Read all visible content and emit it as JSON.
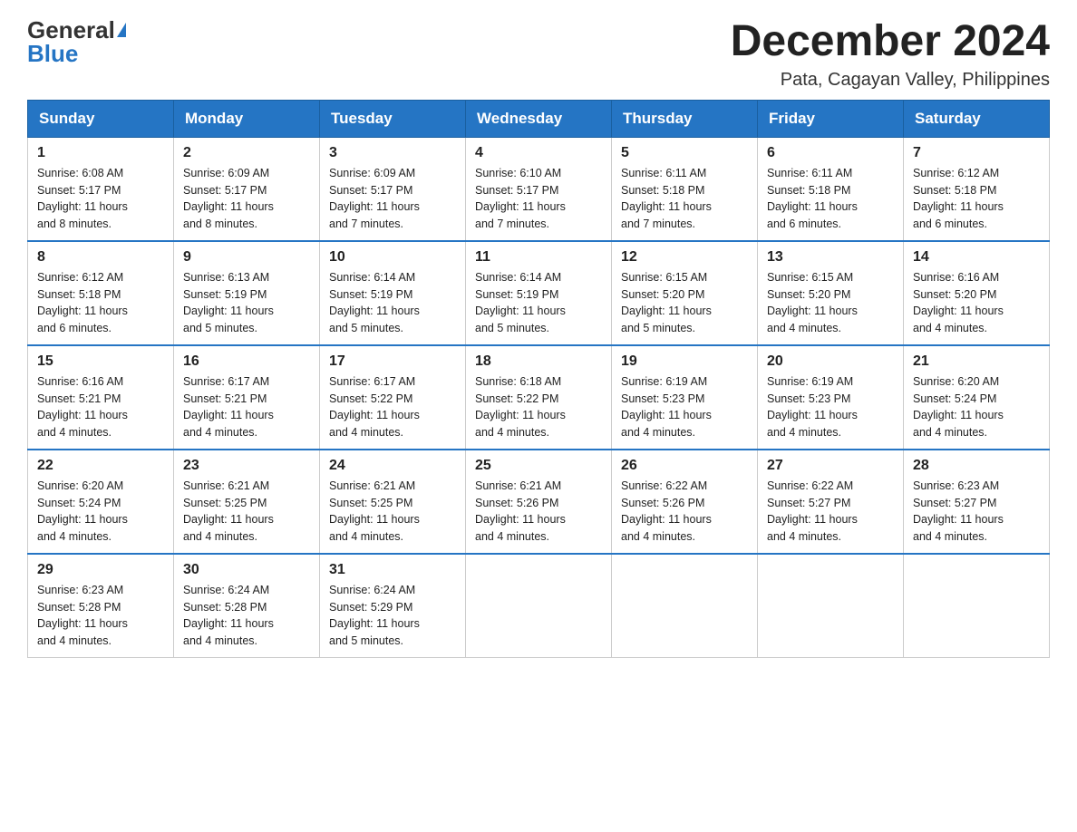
{
  "header": {
    "logo_general": "General",
    "logo_blue": "Blue",
    "month_title": "December 2024",
    "location": "Pata, Cagayan Valley, Philippines"
  },
  "weekdays": [
    "Sunday",
    "Monday",
    "Tuesday",
    "Wednesday",
    "Thursday",
    "Friday",
    "Saturday"
  ],
  "weeks": [
    [
      {
        "day": "1",
        "sunrise": "6:08 AM",
        "sunset": "5:17 PM",
        "daylight": "11 hours and 8 minutes."
      },
      {
        "day": "2",
        "sunrise": "6:09 AM",
        "sunset": "5:17 PM",
        "daylight": "11 hours and 8 minutes."
      },
      {
        "day": "3",
        "sunrise": "6:09 AM",
        "sunset": "5:17 PM",
        "daylight": "11 hours and 7 minutes."
      },
      {
        "day": "4",
        "sunrise": "6:10 AM",
        "sunset": "5:17 PM",
        "daylight": "11 hours and 7 minutes."
      },
      {
        "day": "5",
        "sunrise": "6:11 AM",
        "sunset": "5:18 PM",
        "daylight": "11 hours and 7 minutes."
      },
      {
        "day": "6",
        "sunrise": "6:11 AM",
        "sunset": "5:18 PM",
        "daylight": "11 hours and 6 minutes."
      },
      {
        "day": "7",
        "sunrise": "6:12 AM",
        "sunset": "5:18 PM",
        "daylight": "11 hours and 6 minutes."
      }
    ],
    [
      {
        "day": "8",
        "sunrise": "6:12 AM",
        "sunset": "5:18 PM",
        "daylight": "11 hours and 6 minutes."
      },
      {
        "day": "9",
        "sunrise": "6:13 AM",
        "sunset": "5:19 PM",
        "daylight": "11 hours and 5 minutes."
      },
      {
        "day": "10",
        "sunrise": "6:14 AM",
        "sunset": "5:19 PM",
        "daylight": "11 hours and 5 minutes."
      },
      {
        "day": "11",
        "sunrise": "6:14 AM",
        "sunset": "5:19 PM",
        "daylight": "11 hours and 5 minutes."
      },
      {
        "day": "12",
        "sunrise": "6:15 AM",
        "sunset": "5:20 PM",
        "daylight": "11 hours and 5 minutes."
      },
      {
        "day": "13",
        "sunrise": "6:15 AM",
        "sunset": "5:20 PM",
        "daylight": "11 hours and 4 minutes."
      },
      {
        "day": "14",
        "sunrise": "6:16 AM",
        "sunset": "5:20 PM",
        "daylight": "11 hours and 4 minutes."
      }
    ],
    [
      {
        "day": "15",
        "sunrise": "6:16 AM",
        "sunset": "5:21 PM",
        "daylight": "11 hours and 4 minutes."
      },
      {
        "day": "16",
        "sunrise": "6:17 AM",
        "sunset": "5:21 PM",
        "daylight": "11 hours and 4 minutes."
      },
      {
        "day": "17",
        "sunrise": "6:17 AM",
        "sunset": "5:22 PM",
        "daylight": "11 hours and 4 minutes."
      },
      {
        "day": "18",
        "sunrise": "6:18 AM",
        "sunset": "5:22 PM",
        "daylight": "11 hours and 4 minutes."
      },
      {
        "day": "19",
        "sunrise": "6:19 AM",
        "sunset": "5:23 PM",
        "daylight": "11 hours and 4 minutes."
      },
      {
        "day": "20",
        "sunrise": "6:19 AM",
        "sunset": "5:23 PM",
        "daylight": "11 hours and 4 minutes."
      },
      {
        "day": "21",
        "sunrise": "6:20 AM",
        "sunset": "5:24 PM",
        "daylight": "11 hours and 4 minutes."
      }
    ],
    [
      {
        "day": "22",
        "sunrise": "6:20 AM",
        "sunset": "5:24 PM",
        "daylight": "11 hours and 4 minutes."
      },
      {
        "day": "23",
        "sunrise": "6:21 AM",
        "sunset": "5:25 PM",
        "daylight": "11 hours and 4 minutes."
      },
      {
        "day": "24",
        "sunrise": "6:21 AM",
        "sunset": "5:25 PM",
        "daylight": "11 hours and 4 minutes."
      },
      {
        "day": "25",
        "sunrise": "6:21 AM",
        "sunset": "5:26 PM",
        "daylight": "11 hours and 4 minutes."
      },
      {
        "day": "26",
        "sunrise": "6:22 AM",
        "sunset": "5:26 PM",
        "daylight": "11 hours and 4 minutes."
      },
      {
        "day": "27",
        "sunrise": "6:22 AM",
        "sunset": "5:27 PM",
        "daylight": "11 hours and 4 minutes."
      },
      {
        "day": "28",
        "sunrise": "6:23 AM",
        "sunset": "5:27 PM",
        "daylight": "11 hours and 4 minutes."
      }
    ],
    [
      {
        "day": "29",
        "sunrise": "6:23 AM",
        "sunset": "5:28 PM",
        "daylight": "11 hours and 4 minutes."
      },
      {
        "day": "30",
        "sunrise": "6:24 AM",
        "sunset": "5:28 PM",
        "daylight": "11 hours and 4 minutes."
      },
      {
        "day": "31",
        "sunrise": "6:24 AM",
        "sunset": "5:29 PM",
        "daylight": "11 hours and 5 minutes."
      },
      null,
      null,
      null,
      null
    ]
  ],
  "labels": {
    "sunrise_prefix": "Sunrise: ",
    "sunset_prefix": "Sunset: ",
    "daylight_prefix": "Daylight: "
  }
}
